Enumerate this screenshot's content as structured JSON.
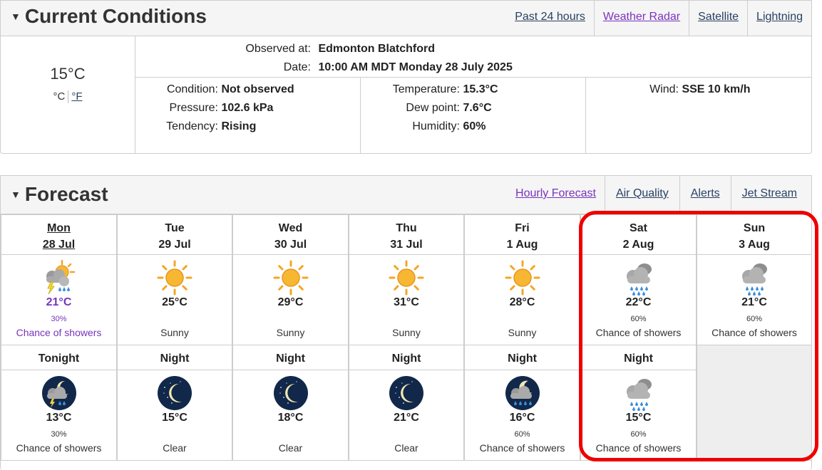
{
  "current": {
    "title": "Current Conditions",
    "links": [
      {
        "label": "Past 24 hours",
        "visited": false
      },
      {
        "label": "Weather Radar",
        "visited": true
      },
      {
        "label": "Satellite",
        "visited": false
      },
      {
        "label": "Lightning",
        "visited": false
      }
    ],
    "temp": "15°C",
    "unit_c": "°C",
    "unit_f": "°F",
    "observed_label": "Observed at:",
    "observed_value": "Edmonton Blatchford",
    "date_label": "Date:",
    "date_value": "10:00 AM MDT Monday 28 July 2025",
    "condition_label": "Condition:",
    "condition_value": "Not observed",
    "pressure_label": "Pressure:",
    "pressure_value": "102.6 kPa",
    "tendency_label": "Tendency:",
    "tendency_value": "Rising",
    "temperature_label": "Temperature:",
    "temperature_value": "15.3°C",
    "dewpoint_label": "Dew point:",
    "dewpoint_value": "7.6°C",
    "humidity_label": "Humidity:",
    "humidity_value": "60%",
    "wind_label": "Wind:",
    "wind_value": "SSE 10 km/h"
  },
  "forecast": {
    "title": "Forecast",
    "links": [
      {
        "label": "Hourly Forecast",
        "visited": true
      },
      {
        "label": "Air Quality",
        "visited": false
      },
      {
        "label": "Alerts",
        "visited": false
      },
      {
        "label": "Jet Stream",
        "visited": false
      }
    ],
    "days": [
      {
        "day": "Mon",
        "date": "28 Jul",
        "today": true,
        "icon": "sun-cloud-lightning-showers-icon",
        "temp": "21°C",
        "pop": "30%",
        "cond": "Chance of showers",
        "purple": true
      },
      {
        "day": "Tue",
        "date": "29 Jul",
        "icon": "sun-icon",
        "temp": "25°C",
        "pop": "",
        "cond": "Sunny"
      },
      {
        "day": "Wed",
        "date": "30 Jul",
        "icon": "sun-icon",
        "temp": "29°C",
        "pop": "",
        "cond": "Sunny"
      },
      {
        "day": "Thu",
        "date": "31 Jul",
        "icon": "sun-icon",
        "temp": "31°C",
        "pop": "",
        "cond": "Sunny"
      },
      {
        "day": "Fri",
        "date": "1 Aug",
        "icon": "sun-icon",
        "temp": "28°C",
        "pop": "",
        "cond": "Sunny"
      },
      {
        "day": "Sat",
        "date": "2 Aug",
        "icon": "cloud-rain-icon",
        "temp": "22°C",
        "pop": "60%",
        "cond": "Chance of showers"
      },
      {
        "day": "Sun",
        "date": "3 Aug",
        "icon": "cloud-rain-icon",
        "temp": "21°C",
        "pop": "60%",
        "cond": "Chance of showers"
      }
    ],
    "nights": [
      {
        "label": "Tonight",
        "icon": "moon-cloud-lightning-icon",
        "temp": "13°C",
        "pop": "30%",
        "cond": "Chance of showers"
      },
      {
        "label": "Night",
        "icon": "moon-clear-icon",
        "temp": "15°C",
        "pop": "",
        "cond": "Clear"
      },
      {
        "label": "Night",
        "icon": "moon-clear-icon",
        "temp": "18°C",
        "pop": "",
        "cond": "Clear"
      },
      {
        "label": "Night",
        "icon": "moon-clear-icon",
        "temp": "21°C",
        "pop": "",
        "cond": "Clear"
      },
      {
        "label": "Night",
        "icon": "moon-cloud-rain-icon",
        "temp": "16°C",
        "pop": "60%",
        "cond": "Chance of showers"
      },
      {
        "label": "Night",
        "icon": "cloud-rain-icon",
        "temp": "15°C",
        "pop": "60%",
        "cond": "Chance of showers"
      }
    ]
  }
}
